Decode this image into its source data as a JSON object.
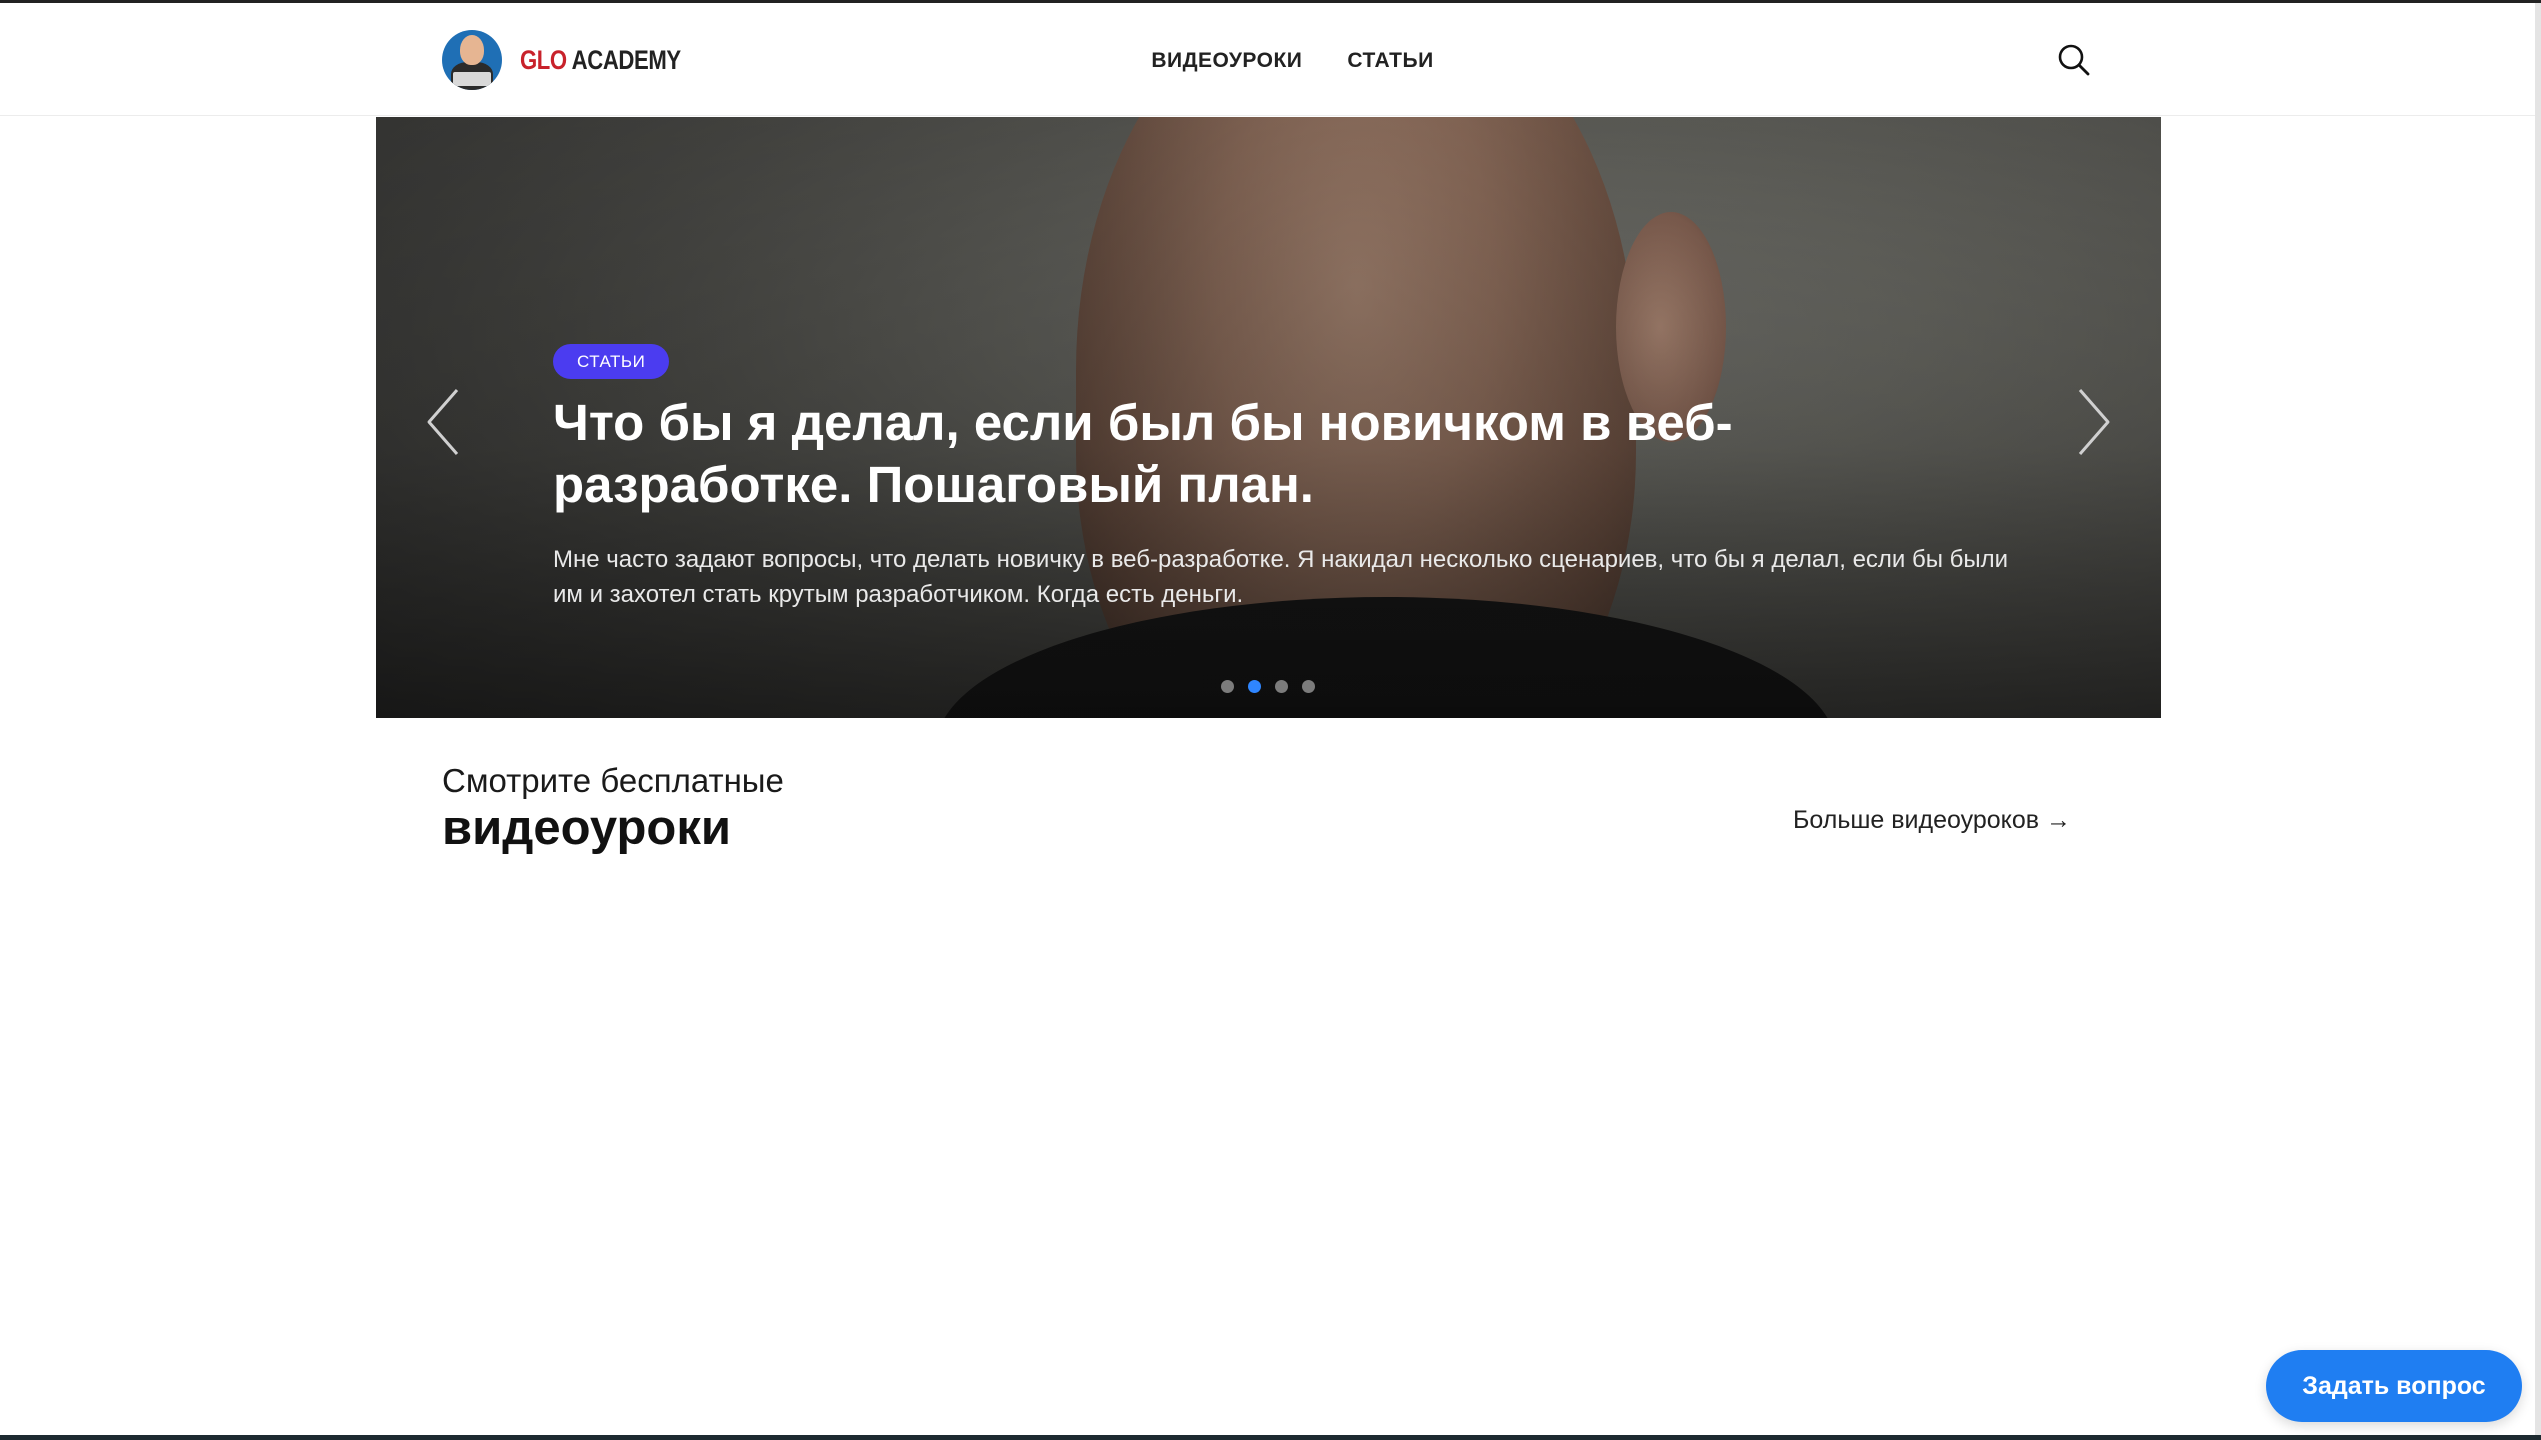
{
  "header": {
    "logo": {
      "glo": "GLO",
      "academy": "ACADEMY"
    },
    "nav": [
      {
        "label": "ВИДЕОУРОКИ"
      },
      {
        "label": "СТАТЬИ"
      }
    ],
    "search_icon": "search-icon"
  },
  "hero": {
    "badge": "СТАТЬИ",
    "title": "Что бы я делал, если был бы новичком в веб-разработке. Пошаговый план.",
    "description": "Мне часто задают вопросы, что делать новичку в веб-разработке. Я накидал несколько сценариев, что бы я делал, если бы были им и захотел стать крутым разработчиком. Когда есть деньги.",
    "slides_total": 4,
    "active_slide": 2,
    "prev_icon": "chevron-left-icon",
    "next_icon": "chevron-right-icon"
  },
  "section": {
    "subtitle": "Смотрите бесплатные",
    "title": "видеоуроки",
    "more_link": "Больше видеоуроков →"
  },
  "ask_button": "Задать вопрос",
  "colors": {
    "badge": "#4b3cf0",
    "active_dot": "#2f86ff",
    "ask_button": "#1f7ef2",
    "logo_red": "#c8222b"
  }
}
